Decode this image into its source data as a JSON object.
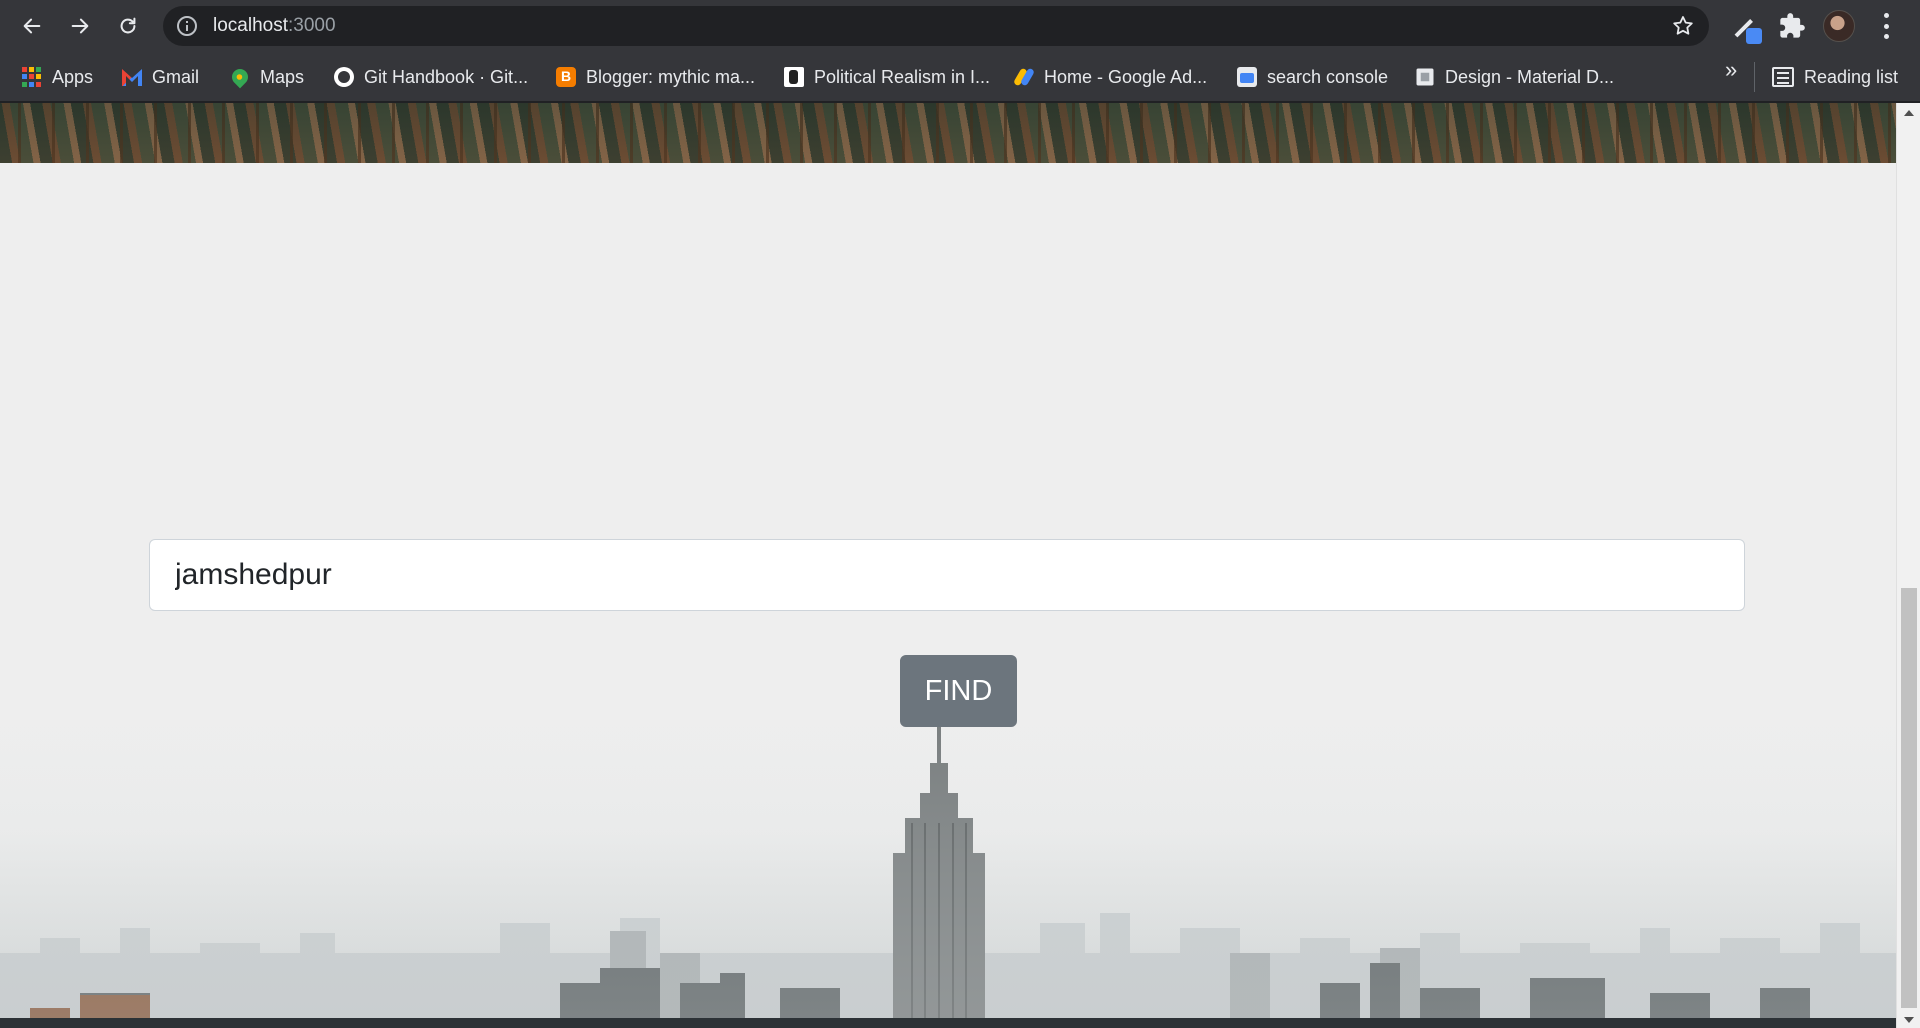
{
  "browser": {
    "url_host": "localhost",
    "url_port": ":3000",
    "icons": {
      "back": "arrow-left-icon",
      "forward": "arrow-right-icon",
      "reload": "reload-icon",
      "site_info": "info-icon",
      "bookmark_star": "star-icon",
      "extensions": "puzzle-icon",
      "menu": "kebab-icon"
    },
    "bookmarks": [
      {
        "label": "Apps",
        "icon": "apps-grid-icon"
      },
      {
        "label": "Gmail",
        "icon": "gmail-icon"
      },
      {
        "label": "Maps",
        "icon": "maps-icon"
      },
      {
        "label": "Git Handbook · Git...",
        "icon": "github-icon"
      },
      {
        "label": "Blogger: mythic ma...",
        "icon": "blogger-icon"
      },
      {
        "label": "Political Realism in I...",
        "icon": "fist-icon"
      },
      {
        "label": "Home - Google Ad...",
        "icon": "google-ads-icon"
      },
      {
        "label": "search console",
        "icon": "search-console-icon"
      },
      {
        "label": "Design - Material D...",
        "icon": "material-design-icon"
      }
    ],
    "overflow_label": "»",
    "reading_list_label": "Reading list"
  },
  "page": {
    "search": {
      "value": "jamshedpur",
      "placeholder": ""
    },
    "find_button_label": "FIND"
  },
  "colors": {
    "chrome_toolbar": "#35363a",
    "omnibox": "#202124",
    "page_background": "#eeeeee",
    "button": "#6c757d"
  }
}
